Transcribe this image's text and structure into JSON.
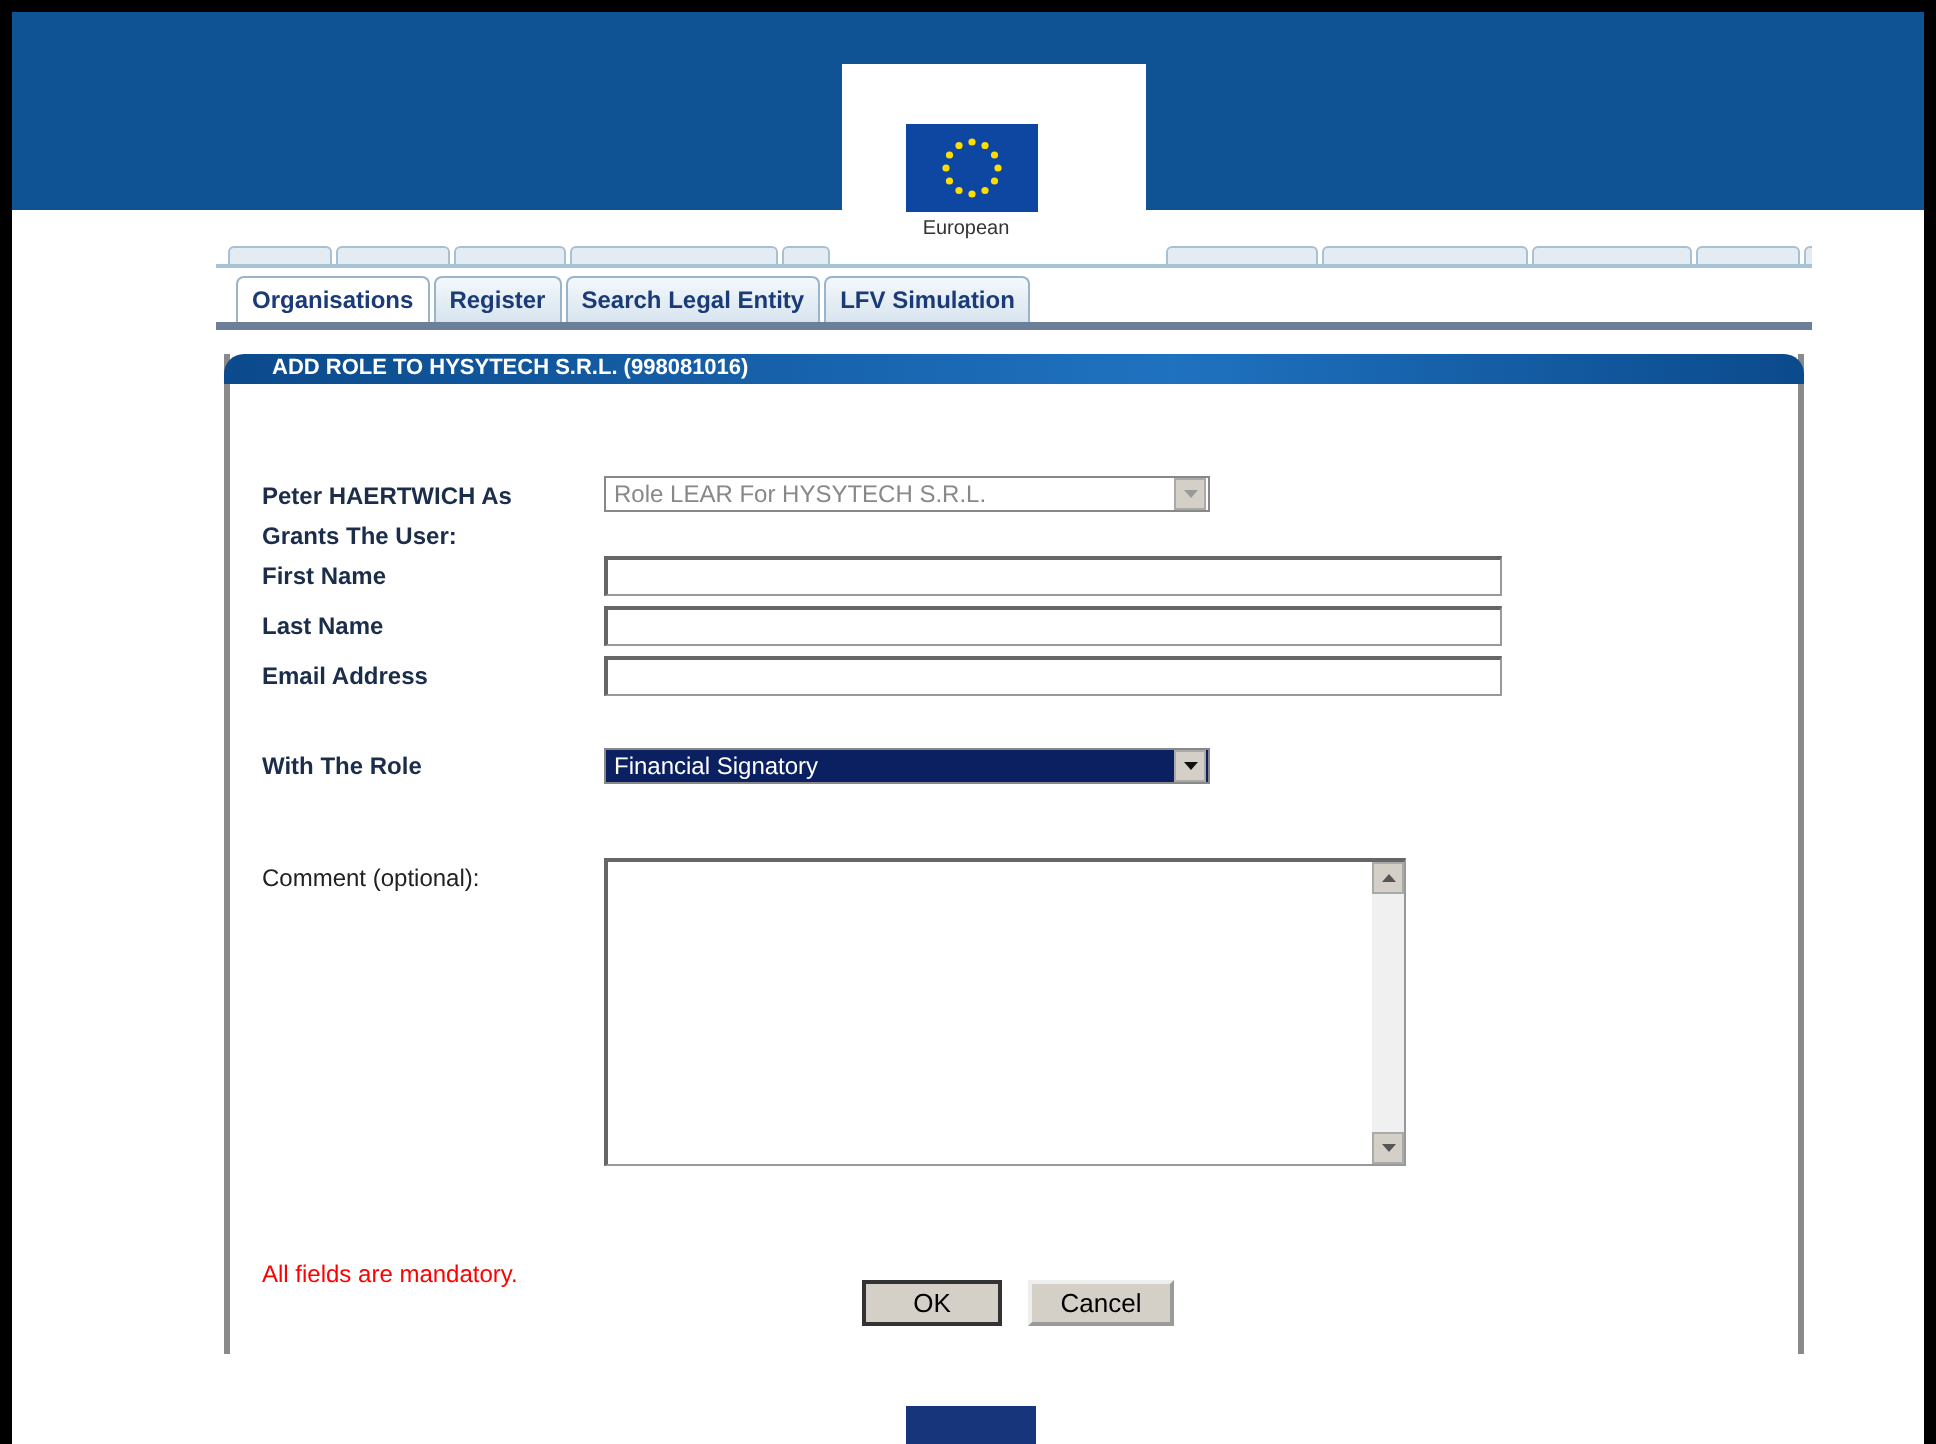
{
  "header": {
    "logo_caption": "European"
  },
  "tabs": [
    {
      "label": "Organisations",
      "selected": true
    },
    {
      "label": "Register",
      "selected": false
    },
    {
      "label": "Search Legal Entity",
      "selected": false
    },
    {
      "label": "LFV Simulation",
      "selected": false
    }
  ],
  "panel": {
    "title": "ADD ROLE TO HYSYTECH S.R.L. (998081016)",
    "fields": [
      {
        "kind": "select",
        "label": "Peter HAERTWICH As Grants The User:",
        "value": "Role LEAR For HYSYTECH S.R.L.",
        "disabled": true,
        "selected": false
      },
      {
        "kind": "text",
        "label": "First Name"
      },
      {
        "kind": "text",
        "label": "Last Name"
      },
      {
        "kind": "text",
        "label": "Email Address"
      },
      {
        "kind": "select",
        "label": "With The Role",
        "value": "Financial Signatory",
        "disabled": false,
        "selected": true
      },
      {
        "kind": "textarea",
        "label": "Comment (optional):"
      }
    ],
    "note": "All fields are mandatory.",
    "buttons": [
      {
        "label": "OK",
        "selected": true
      },
      {
        "label": "Cancel",
        "selected": false
      }
    ]
  }
}
